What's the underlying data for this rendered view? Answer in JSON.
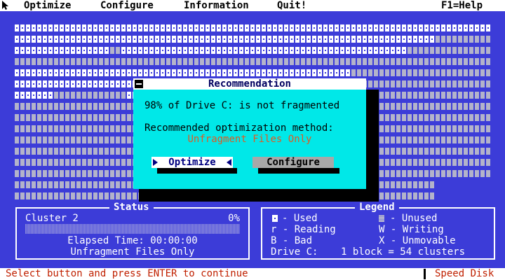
{
  "menu": {
    "items": [
      "Optimize",
      "Configure",
      "Information",
      "Quit!"
    ],
    "help": "F1=Help"
  },
  "dialog": {
    "title": "Recommendation",
    "fragmentation": "98% of Drive C: is not fragmented",
    "recommended_label": "Recommended optimization method:",
    "method": "Unfragment Files Only",
    "optimize_button": "Optimize",
    "configure_button": "Configure"
  },
  "status": {
    "title": "Status",
    "cluster": "Cluster 2",
    "percent": "0%",
    "progress": 0,
    "elapsed": "Elapsed Time: 00:00:00",
    "method": "Unfragment Files Only"
  },
  "legend": {
    "title": "Legend",
    "used": "- Used",
    "unused": "- Unused",
    "reading": "r - Reading",
    "writing": "W - Writing",
    "bad": "B - Bad",
    "unmovable": "X - Unmovable",
    "drive": "Drive C:",
    "block": "1 block = 54 clusters"
  },
  "statusbar": {
    "hint": "Select button and press ENTER to continue",
    "app": "Speed Disk"
  },
  "colors": {
    "background": "#3c3cd8",
    "dialog": "#00e8e8",
    "method_text": "#e05a20",
    "statusbar_text": "#c02000"
  }
}
